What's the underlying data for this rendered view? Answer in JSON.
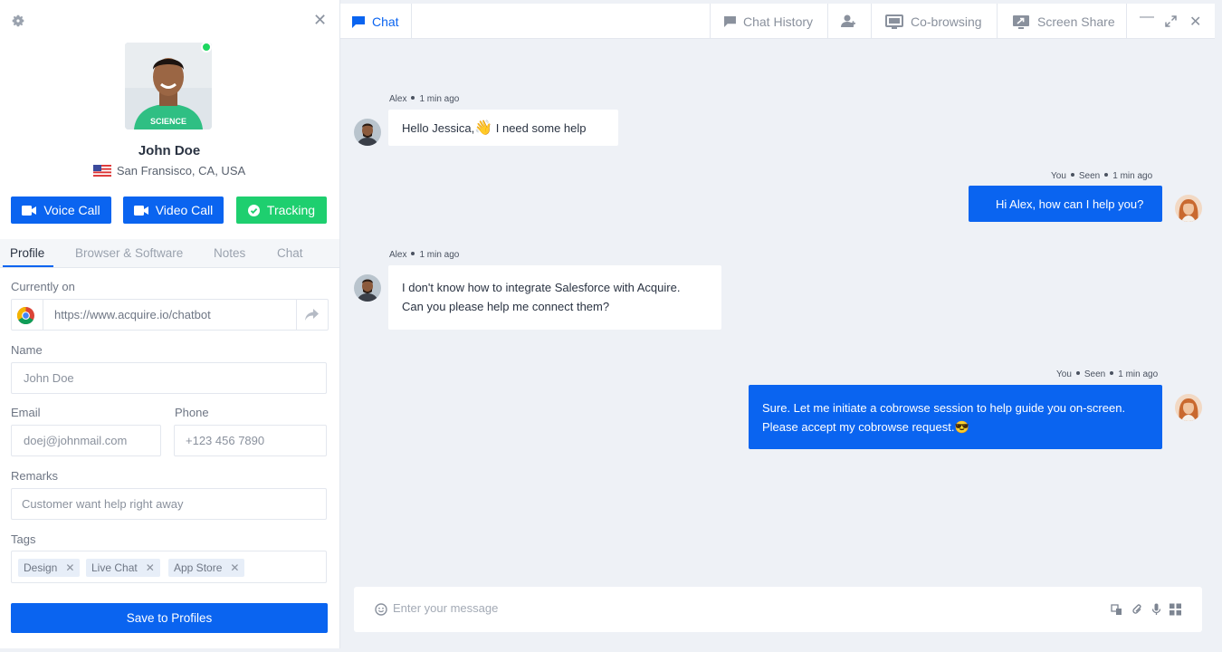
{
  "profile": {
    "name": "John Doe",
    "location": "San Fransisco, CA, USA",
    "online": true
  },
  "actions": {
    "voice_call": "Voice Call",
    "video_call": "Video Call",
    "tracking": "Tracking"
  },
  "tabs": [
    {
      "label": "Profile",
      "active": true
    },
    {
      "label": "Browser & Software",
      "active": false
    },
    {
      "label": "Notes",
      "active": false
    },
    {
      "label": "Chat",
      "active": false
    }
  ],
  "form": {
    "currently_on_label": "Currently on",
    "currently_on_url": "https://www.acquire.io/chatbot",
    "name_label": "Name",
    "name_value": "John Doe",
    "email_label": "Email",
    "email_value": "doej@johnmail.com",
    "phone_label": "Phone",
    "phone_value": "+123 456 7890",
    "remarks_label": "Remarks",
    "remarks_value": "Customer want help right away",
    "tags_label": "Tags",
    "tags": [
      "Design",
      "Live Chat",
      "App Store"
    ],
    "save_label": "Save to Profiles"
  },
  "topbar": {
    "chat": "Chat",
    "chat_history": "Chat History",
    "cobrowsing": "Co-browsing",
    "screen_share": "Screen Share"
  },
  "messages": [
    {
      "author": "Alex",
      "time": "1 min ago",
      "direction": "in",
      "text_before_emoji": "Hello Jessica,",
      "emoji": "👋",
      "text_after_emoji": "I need some help"
    },
    {
      "author": "You",
      "status": "Seen",
      "time": "1 min ago",
      "direction": "out",
      "text": "Hi Alex, how can I help you?"
    },
    {
      "author": "Alex",
      "time": "1 min ago",
      "direction": "in",
      "lines": [
        "I don't know how to integrate Salesforce with Acquire.",
        "Can you please help me connect them?"
      ]
    },
    {
      "author": "You",
      "status": "Seen",
      "time": "1 min ago",
      "direction": "out",
      "lines": [
        "Sure. Let me initiate a cobrowse session to help guide you on-screen.",
        "Please accept my cobrowse request."
      ],
      "emoji": "😎"
    }
  ],
  "composer": {
    "placeholder": "Enter your message"
  },
  "colors": {
    "accent": "#0a64f0",
    "success": "#1ecf6f",
    "online": "#1ed760",
    "chat_bg": "#eef1f6"
  },
  "icons": [
    "gear-icon",
    "close-icon",
    "video-camera-icon",
    "check-circle-icon",
    "chrome-icon",
    "share-arrow-icon",
    "chat-bubble-icon",
    "add-user-icon",
    "cobrowse-icon",
    "screen-share-icon",
    "minimize-icon",
    "expand-icon",
    "smile-icon",
    "translate-icon",
    "paperclip-icon",
    "microphone-icon",
    "apps-grid-icon"
  ]
}
